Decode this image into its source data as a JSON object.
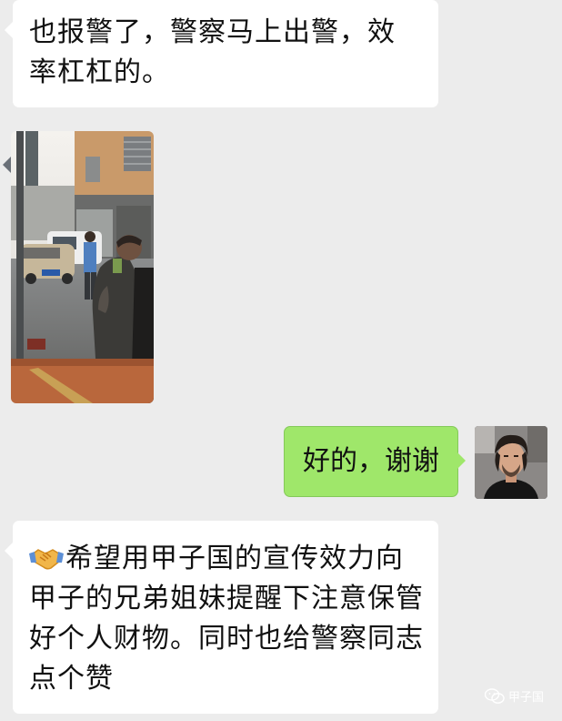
{
  "messages": [
    {
      "id": "msg-1",
      "direction": "incoming",
      "text": "也报警了，警察马上出警，效率杠杠的。"
    },
    {
      "id": "msg-2",
      "direction": "incoming",
      "type": "image"
    },
    {
      "id": "msg-3",
      "direction": "outgoing",
      "text": "好的，谢谢"
    },
    {
      "id": "msg-4",
      "direction": "incoming",
      "emoji": "handshake-icon",
      "text": "希望用甲子国的宣传效力向甲子的兄弟姐妹提醒下注意保管好个人财物。同时也给警察同志点个赞"
    }
  ],
  "watermark": {
    "text": "甲子国",
    "icon": "wechat-icon"
  },
  "colors": {
    "background": "#ececec",
    "incoming_bubble": "#ffffff",
    "outgoing_bubble": "#9fe76a"
  }
}
